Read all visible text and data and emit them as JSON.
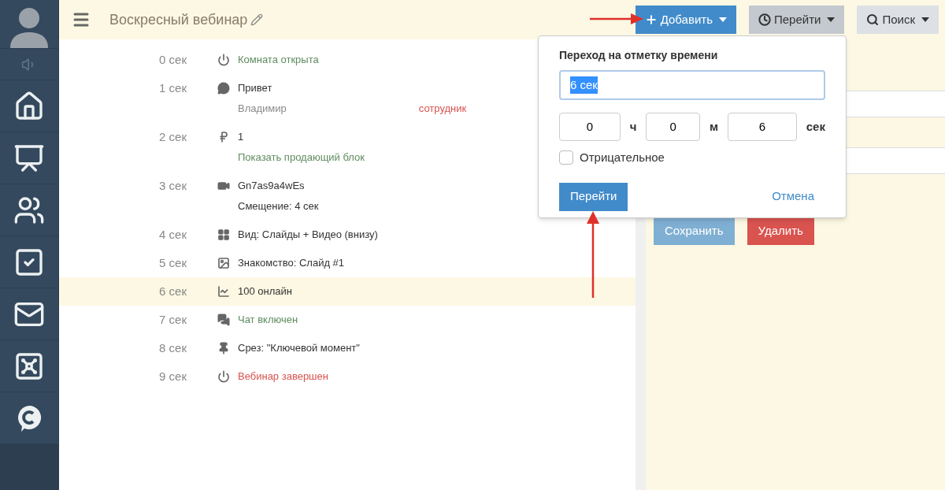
{
  "header": {
    "title": "Воскресный вебинар",
    "buttons": [
      {
        "kind": "add",
        "label": "Добавить",
        "selected": false
      },
      {
        "kind": "goto",
        "label": "Перейти",
        "selected": true
      },
      {
        "kind": "search",
        "label": "Поиск",
        "selected": false
      }
    ]
  },
  "events": [
    {
      "time": "0 сек",
      "kind": "power",
      "selected": false,
      "lines": [
        [
          {
            "text": "Комната открыта",
            "kind": "status"
          }
        ]
      ]
    },
    {
      "time": "1 сек",
      "kind": "chat",
      "selected": false,
      "lines": [
        [
          {
            "text": "Привет",
            "kind": "text"
          }
        ],
        [
          {
            "text": "Владимир",
            "kind": "muted"
          },
          {
            "text": "сотрудник",
            "kind": "alert"
          }
        ]
      ]
    },
    {
      "time": "2 сек",
      "kind": "ruble",
      "selected": false,
      "lines": [
        [
          {
            "text": "1",
            "kind": "text"
          }
        ],
        [
          {
            "text": "Показать продающий блок",
            "kind": "status"
          }
        ]
      ]
    },
    {
      "time": "3 сек",
      "kind": "video",
      "selected": false,
      "lines": [
        [
          {
            "text": "Gn7as9a4wEs",
            "kind": "text"
          }
        ],
        [
          {
            "text": "Смещение: 4 сек",
            "kind": "text"
          }
        ]
      ]
    },
    {
      "time": "4 сек",
      "kind": "layout",
      "selected": false,
      "lines": [
        [
          {
            "text": "Вид: Слайды + Видео (внизу)",
            "kind": "text"
          }
        ]
      ]
    },
    {
      "time": "5 сек",
      "kind": "image",
      "selected": false,
      "lines": [
        [
          {
            "text": "Знакомство: Слайд #1",
            "kind": "text"
          }
        ]
      ]
    },
    {
      "time": "6 сек",
      "kind": "chart",
      "selected": true,
      "lines": [
        [
          {
            "text": "100 онлайн",
            "kind": "text"
          }
        ]
      ]
    },
    {
      "time": "7 сек",
      "kind": "chats",
      "selected": false,
      "lines": [
        [
          {
            "text": "Чат включен",
            "kind": "status"
          }
        ]
      ]
    },
    {
      "time": "8 сек",
      "kind": "pin",
      "selected": false,
      "lines": [
        [
          {
            "text": "Срез: \"Ключевой момент\"",
            "kind": "text"
          }
        ]
      ]
    },
    {
      "time": "9 сек",
      "kind": "power",
      "selected": false,
      "lines": [
        [
          {
            "text": "Вебинар завершен",
            "kind": "alert"
          }
        ]
      ]
    }
  ],
  "side_panel": {
    "buttons": [
      {
        "kind": "save",
        "label": "Сохранить",
        "disabled": true
      },
      {
        "kind": "delete",
        "label": "Удалить",
        "disabled": false
      }
    ]
  },
  "popover": {
    "title": "Переход на отметку времени",
    "value": "6 сек",
    "hours": "0",
    "hours_unit": "ч",
    "minutes": "0",
    "minutes_unit": "м",
    "seconds": "6",
    "seconds_unit": "сек",
    "negative": {
      "label": "Отрицательное",
      "checked": false
    },
    "submit": "Перейти",
    "cancel": "Отмена"
  }
}
